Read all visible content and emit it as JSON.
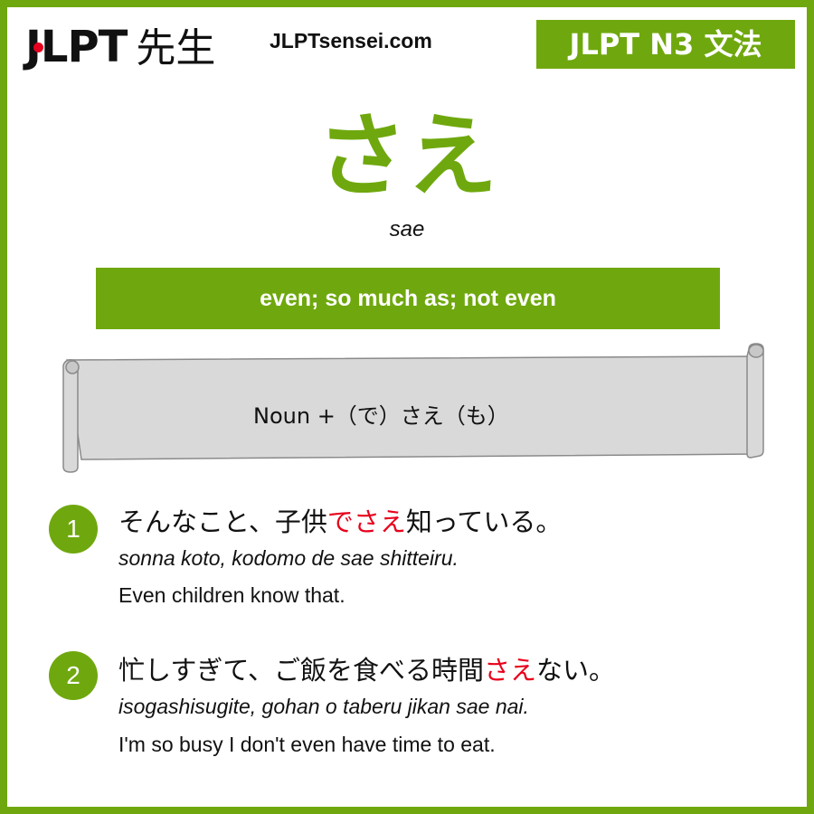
{
  "header": {
    "logo_text": "JLPT",
    "logo_kanji": "先生",
    "site": "JLPTsensei.com",
    "level_badge": "JLPT N3 文法"
  },
  "grammar": {
    "title": "さえ",
    "romaji": "sae",
    "meaning": "even; so much as; not even",
    "formation": "Noun +（で）さえ（も）"
  },
  "examples": [
    {
      "number": "1",
      "jp_before": "そんなこと、子供",
      "jp_highlight": "でさえ",
      "jp_after": "知っている。",
      "romaji": "sonna koto, kodomo de sae shitteiru.",
      "english": "Even children know that."
    },
    {
      "number": "2",
      "jp_before": "忙しすぎて、ご飯を食べる時間",
      "jp_highlight": "さえ",
      "jp_after": "ない。",
      "romaji": "isogashisugite, gohan o taberu jikan sae nai.",
      "english": "I'm so busy I don't even have time to eat."
    }
  ],
  "colors": {
    "accent": "#6fa80e",
    "highlight": "#e8001c",
    "scroll_fill": "#d9d9d9"
  }
}
